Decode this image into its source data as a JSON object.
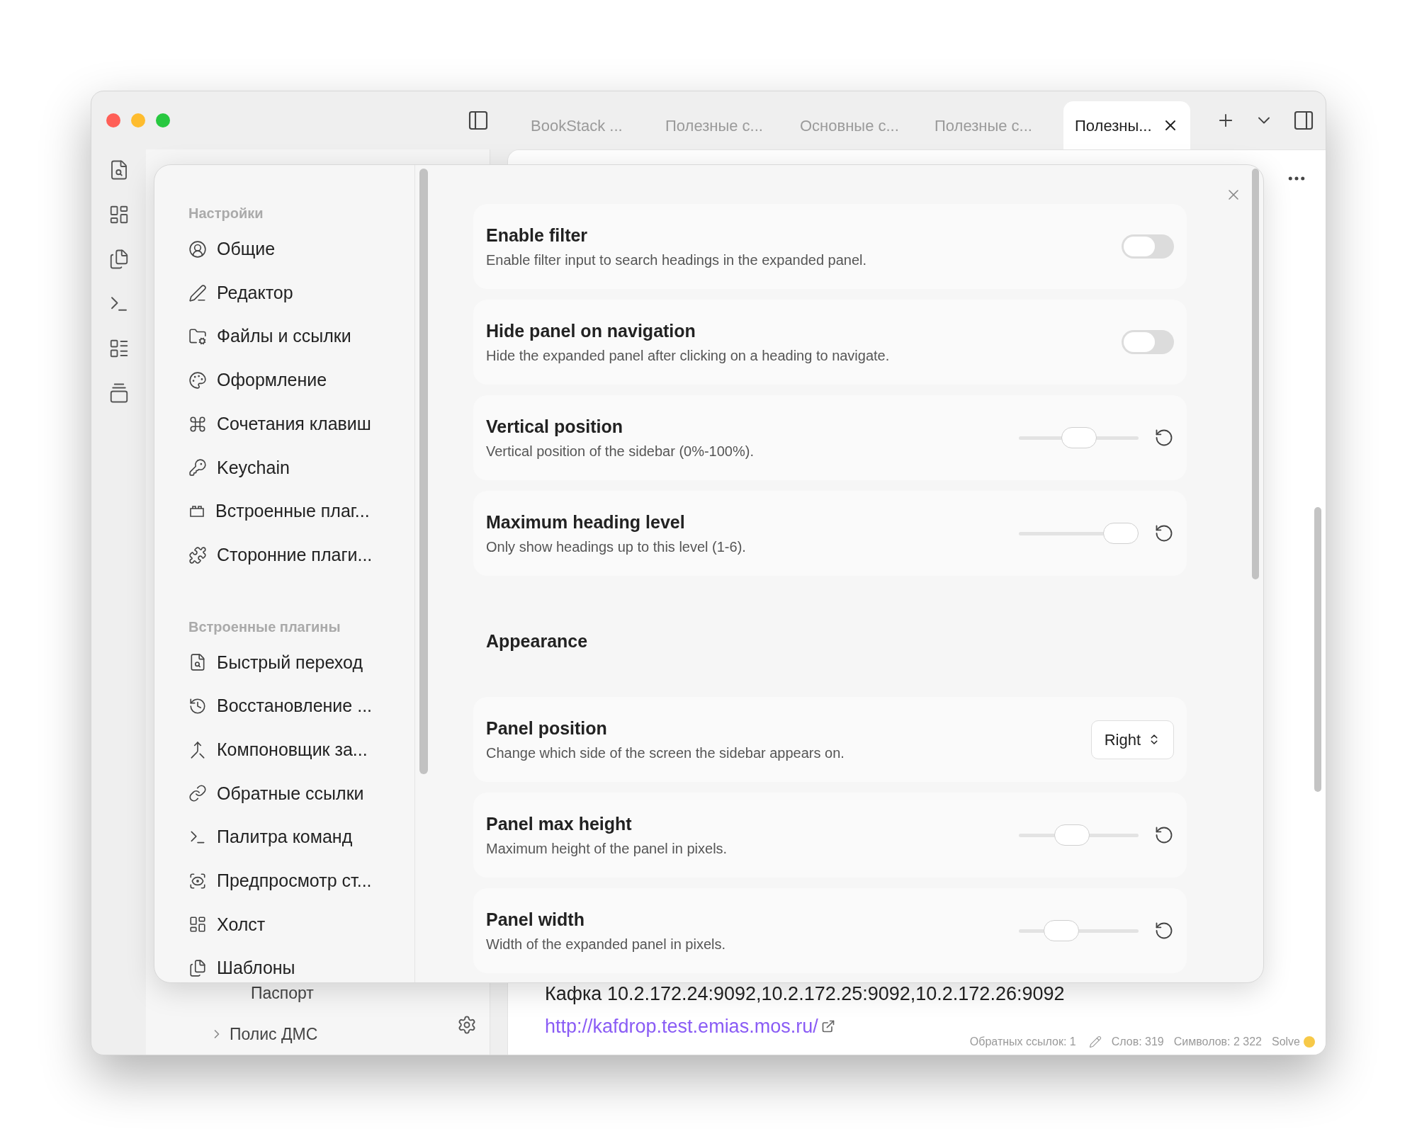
{
  "tabs": [
    {
      "label": "BookStack ...",
      "selected": false
    },
    {
      "label": "Полезные с...",
      "selected": false
    },
    {
      "label": "Основные с...",
      "selected": false
    },
    {
      "label": "Полезные с...",
      "selected": false
    },
    {
      "label": "Полезны...",
      "selected": true
    }
  ],
  "file_tree": [
    {
      "kind": "file",
      "label": "Паспорт"
    },
    {
      "kind": "folder",
      "label": "Полис ДМС",
      "expanded": false
    }
  ],
  "note": [
    {
      "kind": "text",
      "text": "Кафка 10.2.172.24:9092,10.2.172.25:9092,10.2.172.26:9092"
    },
    {
      "kind": "link",
      "text": "http://kafdrop.test.emias.mos.ru/"
    }
  ],
  "status_bar": {
    "backlinks": "Обратных ссылок: 1",
    "words": "Слов: 319",
    "characters": "Символов: 2 322",
    "sync": "Solve"
  },
  "settings": {
    "sidebar": [
      {
        "heading": "Настройки",
        "items": [
          {
            "label": "Общие",
            "selected": false
          },
          {
            "label": "Редактор",
            "selected": false
          },
          {
            "label": "Файлы и ссылки",
            "selected": false
          },
          {
            "label": "Оформление",
            "selected": false
          },
          {
            "label": "Сочетания клавиш",
            "selected": false
          },
          {
            "label": "Keychain",
            "selected": false
          },
          {
            "label": "Встроенные плаг...",
            "selected": false
          },
          {
            "label": "Сторонние плаги...",
            "selected": false
          }
        ]
      },
      {
        "heading": "Встроенные плагины",
        "items": [
          {
            "label": "Быстрый переход",
            "selected": false
          },
          {
            "label": "Восстановление ...",
            "selected": false
          },
          {
            "label": "Компоновщик за...",
            "selected": false
          },
          {
            "label": "Обратные ссылки",
            "selected": false
          },
          {
            "label": "Палитра команд",
            "selected": false
          },
          {
            "label": "Предпросмотр ст...",
            "selected": false
          },
          {
            "label": "Холст",
            "selected": false
          },
          {
            "label": "Шаблоны",
            "selected": false
          }
        ]
      }
    ],
    "rows": [
      {
        "kind": "toggle",
        "title": "Enable filter",
        "description": "Enable filter input to search headings in the expanded panel.",
        "on": false
      },
      {
        "kind": "toggle",
        "title": "Hide panel on navigation",
        "description": "Hide the expanded panel after clicking on a heading to navigate.",
        "on": false
      },
      {
        "kind": "slider",
        "title": "Vertical position",
        "description": "Vertical position of the sidebar (0%-100%).",
        "level": 0.5
      },
      {
        "kind": "slider",
        "title": "Maximum heading level",
        "description": "Only show headings up to this level (1-6).",
        "level": 1
      },
      {
        "kind": "heading",
        "title": "Appearance"
      },
      {
        "kind": "select",
        "title": "Panel position",
        "description": "Change which side of the screen the sidebar appears on.",
        "value": "Right"
      },
      {
        "kind": "slider",
        "title": "Panel max height",
        "description": "Maximum height of the panel in pixels.",
        "level": 0.42
      },
      {
        "kind": "slider",
        "title": "Panel width",
        "description": "Width of the expanded panel in pixels.",
        "level": 0.29
      }
    ]
  }
}
